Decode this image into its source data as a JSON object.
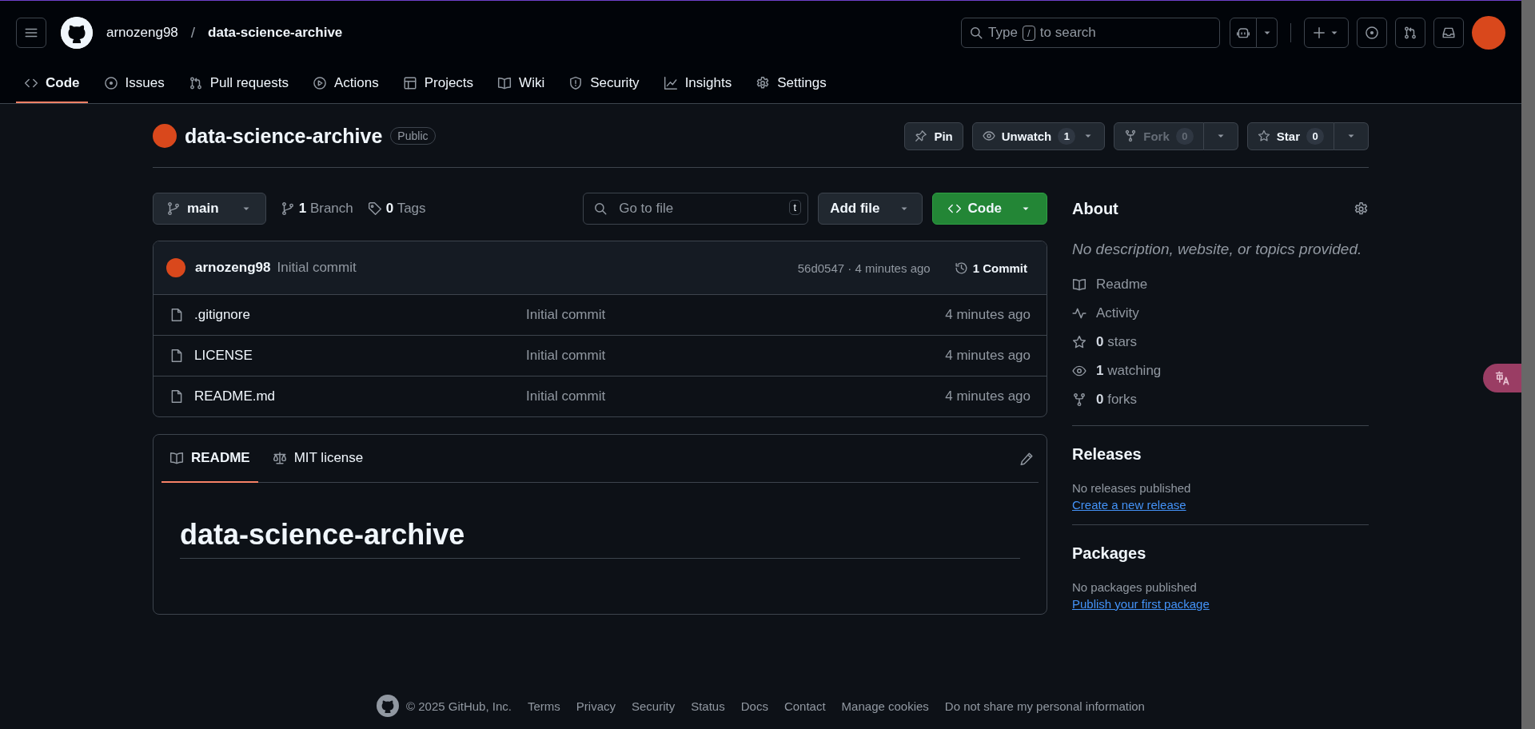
{
  "top_bar": {
    "owner": "arnozeng98",
    "separator": "/",
    "repository": "data-science-archive",
    "search": {
      "prefix": "Type",
      "key": "/",
      "suffix": "to search"
    }
  },
  "repo_tabs": [
    {
      "label": "Code",
      "selected": true
    },
    {
      "label": "Issues",
      "selected": false
    },
    {
      "label": "Pull requests",
      "selected": false
    },
    {
      "label": "Actions",
      "selected": false
    },
    {
      "label": "Projects",
      "selected": false
    },
    {
      "label": "Wiki",
      "selected": false
    },
    {
      "label": "Security",
      "selected": false
    },
    {
      "label": "Insights",
      "selected": false
    },
    {
      "label": "Settings",
      "selected": false
    }
  ],
  "repo_header": {
    "name": "data-science-archive",
    "visibility": "Public",
    "actions": [
      {
        "kind": "plain",
        "label": "Pin",
        "disabled": false
      },
      {
        "kind": "inline",
        "label": "Unwatch",
        "count": "1",
        "disabled": false
      },
      {
        "kind": "split",
        "label": "Fork",
        "count": "0",
        "disabled": true
      },
      {
        "kind": "split",
        "label": "Star",
        "count": "0",
        "disabled": false
      }
    ]
  },
  "code_bar": {
    "branch": "main",
    "branches": "**1** Branch",
    "tags": "**0** Tags",
    "file_search": {
      "placeholder": "Go to file",
      "shortcut": "t"
    },
    "add_file": "Add file",
    "code": "Code"
  },
  "latest_commit": {
    "author": "arnozeng98",
    "message": "Initial commit",
    "hash_time": "56d0547 · 4 minutes ago",
    "commits": "1 Commit"
  },
  "files": [
    {
      "name": ".gitignore",
      "message": "Initial commit",
      "time": "4 minutes ago"
    },
    {
      "name": "LICENSE",
      "message": "Initial commit",
      "time": "4 minutes ago"
    },
    {
      "name": "README.md",
      "message": "Initial commit",
      "time": "4 minutes ago"
    }
  ],
  "readme": {
    "tabs": [
      {
        "label": "README",
        "selected": true
      },
      {
        "label": "MIT license",
        "selected": false
      }
    ],
    "heading": "data-science-archive"
  },
  "about": {
    "title": "About",
    "description": "No description, website, or topics provided.",
    "items": [
      {
        "text": "Readme"
      },
      {
        "text": "Activity"
      },
      {
        "text": "**0** stars"
      },
      {
        "text": "**1** watching"
      },
      {
        "text": "**0** forks"
      }
    ]
  },
  "releases": {
    "title": "Releases",
    "note": "No releases published",
    "link": "Create a new release"
  },
  "packages": {
    "title": "Packages",
    "note": "No packages published",
    "link": "Publish your first package"
  },
  "footer": {
    "copyright": "© 2025 GitHub, Inc.",
    "links": [
      "Terms",
      "Privacy",
      "Security",
      "Status",
      "Docs",
      "Contact",
      "Manage cookies",
      "Do not share my personal information"
    ]
  }
}
